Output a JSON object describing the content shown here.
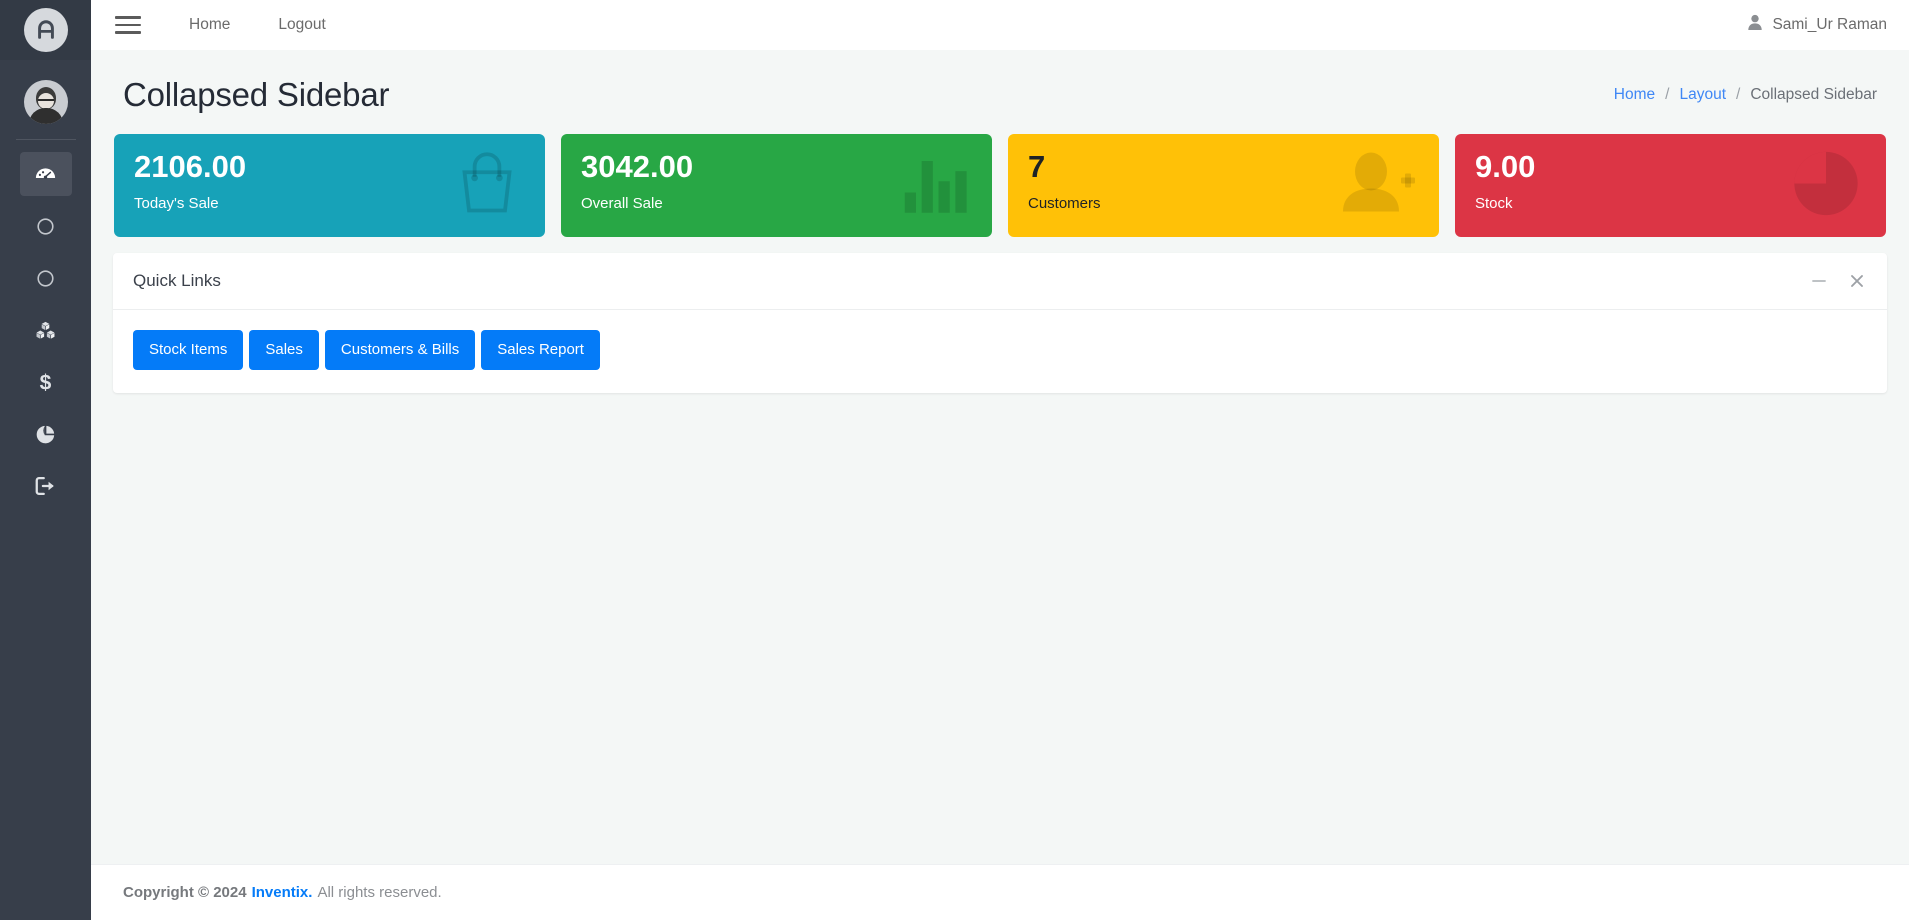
{
  "sidebar": {
    "brand_icon": "app-logo-icon",
    "avatar_name": "user-avatar",
    "items": [
      {
        "name": "dashboard",
        "icon": "tachometer-icon",
        "active": true
      },
      {
        "name": "circle-1",
        "icon": "circle-icon",
        "active": false
      },
      {
        "name": "circle-2",
        "icon": "circle-icon",
        "active": false
      },
      {
        "name": "stock",
        "icon": "cubes-icon",
        "active": false
      },
      {
        "name": "sales",
        "icon": "dollar-sign-icon",
        "active": false
      },
      {
        "name": "reports",
        "icon": "pie-chart-icon",
        "active": false
      },
      {
        "name": "logout",
        "icon": "sign-out-icon",
        "active": false
      }
    ]
  },
  "topbar": {
    "menu_icon": "hamburger-icon",
    "links": [
      {
        "label": "Home"
      },
      {
        "label": "Logout"
      }
    ],
    "user_icon": "user-icon",
    "user_name": "Sami_Ur Raman"
  },
  "page": {
    "title": "Collapsed Sidebar",
    "breadcrumb": {
      "home": "Home",
      "section": "Layout",
      "current": "Collapsed Sidebar",
      "separator": "/"
    }
  },
  "stats": [
    {
      "value": "2106.00",
      "label": "Today's Sale",
      "color": "#17a2b8",
      "icon": "shopping-bag-icon",
      "theme": "teal"
    },
    {
      "value": "3042.00",
      "label": "Overall Sale",
      "color": "#28a745",
      "icon": "bar-chart-icon",
      "theme": "green"
    },
    {
      "value": "7",
      "label": "Customers",
      "color": "#ffc107",
      "icon": "user-plus-icon",
      "theme": "yellow"
    },
    {
      "value": "9.00",
      "label": "Stock",
      "color": "#dc3545",
      "icon": "pie-chart-icon",
      "theme": "red"
    }
  ],
  "quick_links": {
    "title": "Quick Links",
    "minimize_icon": "minus-icon",
    "close_icon": "close-icon",
    "buttons": [
      {
        "label": "Stock Items"
      },
      {
        "label": "Sales"
      },
      {
        "label": "Customers & Bills"
      },
      {
        "label": "Sales Report"
      }
    ],
    "button_color": "#047bf8"
  },
  "footer": {
    "copyright": "Copyright © 2024",
    "brand": "Inventix.",
    "rights": "All rights reserved."
  }
}
